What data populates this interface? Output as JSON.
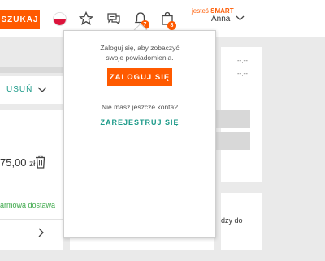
{
  "header": {
    "search_label": "SZUKAJ",
    "flag": "poland-flag",
    "icons": [
      "star-icon",
      "chat-icon",
      "bell-icon",
      "bag-icon"
    ],
    "bell_badge": "7",
    "bag_badge": "8",
    "smart_prefix": "jesteś",
    "smart_brand": "SMART",
    "user_name": "Anna",
    "accent": "#ff5a00"
  },
  "left": {
    "remove_label": "USUŃ",
    "price_main": "75,00",
    "price_currency": "zł",
    "delivery": "armowa dostawa"
  },
  "right": {
    "dash_1": "--,--",
    "dash_2": "--,--",
    "partial_text": "dzy do"
  },
  "popup": {
    "message_line1": "Zaloguj się, aby zobaczyć",
    "message_line2": "swoje powiadomienia.",
    "login_label": "ZALOGUJ SIĘ",
    "no_account": "Nie masz jeszcze konta?",
    "register_label": "ZAREJESTRUJ SIĘ",
    "link_color": "#1e9b8a"
  }
}
